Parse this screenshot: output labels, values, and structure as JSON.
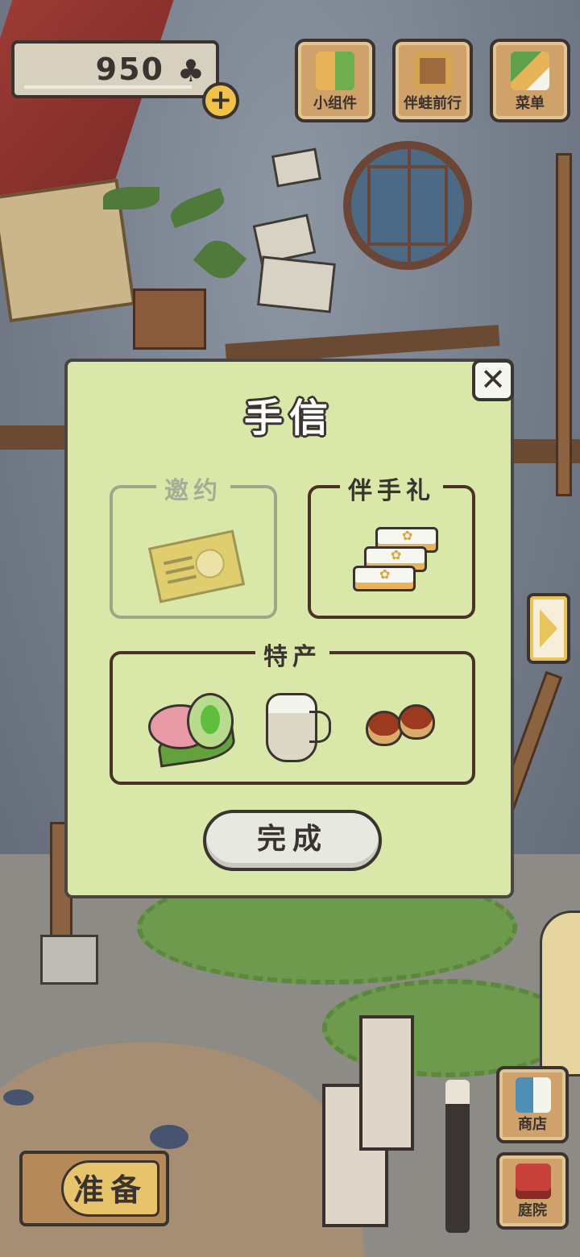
{
  "hud": {
    "currency_value": "950",
    "add_label": "+",
    "buttons": [
      {
        "label": "小组件",
        "icon": "widget-icon"
      },
      {
        "label": "伴蛙前行",
        "icon": "book-icon"
      },
      {
        "label": "菜单",
        "icon": "menu-cards-icon"
      }
    ]
  },
  "dialog": {
    "title": "手信",
    "close_label": "✕",
    "sections": {
      "invite": {
        "caption": "邀约",
        "item_icon": "invitation-letter-icon"
      },
      "gift": {
        "caption": "伴手礼",
        "item_icon": "layered-cake-icon"
      },
      "specialty": {
        "caption": "特产",
        "items": [
          "mochi-icon",
          "milk-jug-icon",
          "chestnut-icon"
        ]
      }
    },
    "done_label": "完成"
  },
  "bottom": {
    "prepare_label": "准备",
    "shop_label": "商店",
    "yard_label": "庭院"
  },
  "colors": {
    "dialog_bg": "#d9e8a8",
    "outline": "#3b3330",
    "wood": "#cfa26b",
    "accent_yellow": "#f1c24a"
  }
}
